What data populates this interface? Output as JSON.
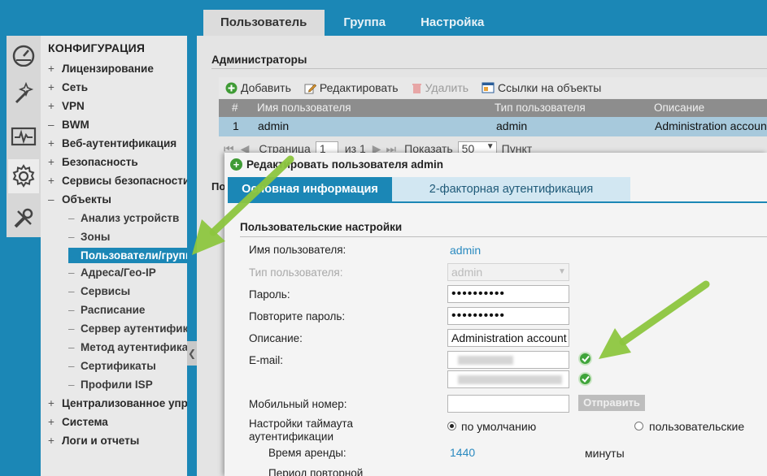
{
  "top_tabs": [
    "Пользователь",
    "Группа",
    "Настройка"
  ],
  "left_icons": [
    "dashboard-icon",
    "wizard-icon",
    "monitor-icon",
    "gear-icon",
    "tools-icon"
  ],
  "nav": {
    "title": "КОНФИГУРАЦИЯ",
    "items": [
      {
        "sign": "+",
        "label": "Лицензирование"
      },
      {
        "sign": "+",
        "label": "Сеть"
      },
      {
        "sign": "+",
        "label": "VPN"
      },
      {
        "sign": "–",
        "label": "BWM"
      },
      {
        "sign": "+",
        "label": "Веб-аутентификация"
      },
      {
        "sign": "+",
        "label": "Безопасность"
      },
      {
        "sign": "+",
        "label": "Сервисы безопасности"
      },
      {
        "sign": "–",
        "label": "Объекты"
      }
    ],
    "sub_items": [
      "Анализ устройств",
      "Зоны",
      "Пользователи/группы",
      "Адреса/Гео-IP",
      "Сервисы",
      "Расписание",
      "Сервер аутентификации",
      "Метод аутентификации",
      "Сертификаты",
      "Профили ISP"
    ],
    "bottom_items": [
      {
        "sign": "+",
        "label": "Централизованное управление"
      },
      {
        "sign": "+",
        "label": "Система"
      },
      {
        "sign": "+",
        "label": "Логи и отчеты"
      }
    ]
  },
  "admins": {
    "title": "Администраторы",
    "toolbar": {
      "add": "Добавить",
      "edit": "Редактировать",
      "delete": "Удалить",
      "refs": "Ссылки на объекты"
    },
    "columns": [
      "#",
      "Имя пользователя",
      "Тип пользователя",
      "Описание"
    ],
    "rows": [
      {
        "num": "1",
        "name": "admin",
        "type": "admin",
        "desc": "Administration account"
      }
    ],
    "pager": {
      "page_label": "Страница",
      "page_value": "1",
      "of_label": "из 1",
      "show_label": "Показать",
      "per_page": "50",
      "item_label": "Пункт"
    }
  },
  "bg_section_label": "По",
  "modal": {
    "title": "Редактировать пользователя admin",
    "tabs": [
      "Основная информация",
      "2-факторная аутентификация"
    ],
    "fieldset_title": "Пользовательские настройки",
    "username_label": "Имя пользователя:",
    "username_value": "admin",
    "usertype_label": "Тип пользователя:",
    "usertype_value": "admin",
    "password_label": "Пароль:",
    "password_value": "••••••••••",
    "password_repeat_label": "Повторите пароль:",
    "password_repeat_value": "••••••••••",
    "description_label": "Описание:",
    "description_value": "Administration account",
    "email_label": "E-mail:",
    "mobile_label": "Мобильный номер:",
    "send_button": "Отправить",
    "timeout_label_1": "Настройки таймаута",
    "timeout_label_2": "аутентификации",
    "radio_default": "по умолчанию",
    "radio_custom": "пользовательские",
    "lease_label": "Время аренды:",
    "lease_value": "1440",
    "lease_unit": "минуты",
    "reauth_label": "Период повторной"
  },
  "colors": {
    "accent": "#1b87b6",
    "arrow": "#8dc63f",
    "ok": "#3fa43a",
    "selected_row": "#a7c9dc"
  }
}
